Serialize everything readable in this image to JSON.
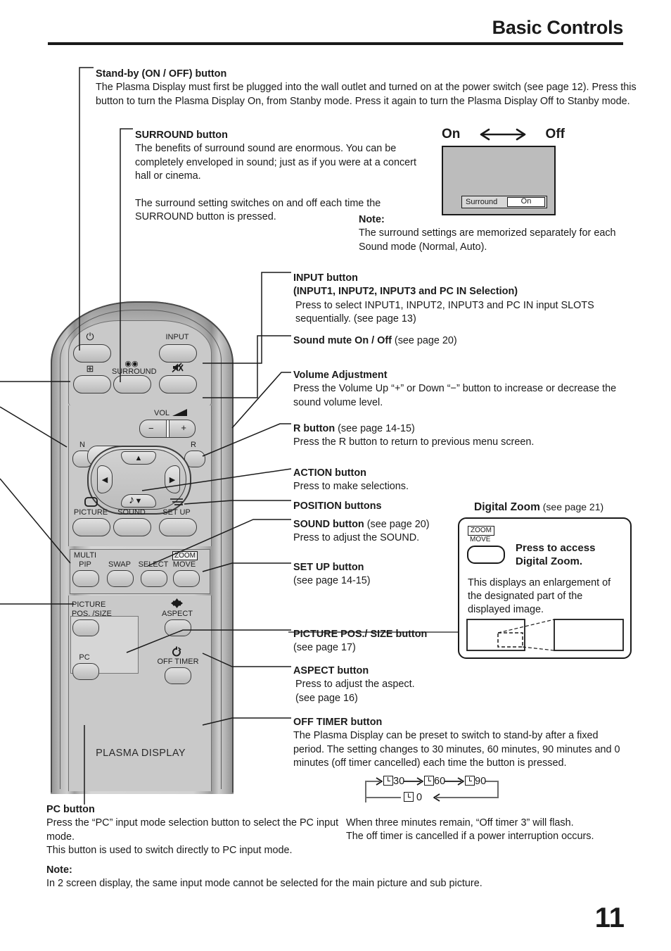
{
  "page": {
    "title": "Basic Controls",
    "number": "11"
  },
  "standby": {
    "heading": "Stand-by (ON / OFF) button",
    "body": "The Plasma Display must first be plugged into the wall outlet and turned on at the power switch (see page 12). Press this button to turn the Plasma Display On, from Stanby mode. Press it again to turn the Plasma Display Off to Stanby mode."
  },
  "surround": {
    "heading": "SURROUND button",
    "body1": "The benefits of surround sound are enormous. You can be completely enveloped in sound; just as if you were at a concert hall or cinema.",
    "body2": "The surround setting switches on and off each time the SURROUND button is pressed.",
    "note_heading": "Note:",
    "note_body": "The surround settings are memorized separately for each Sound mode (Normal, Auto).",
    "on_label": "On",
    "off_label": "Off",
    "osd_label": "Surround",
    "osd_value": "On"
  },
  "input": {
    "heading1": "INPUT button",
    "heading2": "(INPUT1, INPUT2, INPUT3 and PC IN Selection)",
    "body": "Press to select INPUT1, INPUT2, INPUT3 and PC IN input SLOTS sequentially. (see page 13)"
  },
  "mute": {
    "bold": "Sound mute On",
    "sep": " / ",
    "bold2": "Off",
    "normal": " (see page 20)"
  },
  "volume": {
    "heading": "Volume Adjustment",
    "body": "Press the Volume Up “+” or Down “−” button to increase or decrease the sound volume level."
  },
  "rbutton": {
    "heading": "R button",
    "heading_note": " (see page 14-15)",
    "body": "Press the R button to return to previous menu screen."
  },
  "action": {
    "heading": "ACTION button",
    "body": "Press to make selections."
  },
  "position": {
    "heading": "POSITION buttons"
  },
  "sound": {
    "heading": "SOUND button",
    "heading_note": " (see page 20)",
    "body": "Press to adjust the SOUND."
  },
  "setup": {
    "heading": "SET UP button",
    "body": "(see page 14-15)"
  },
  "picture_pos": {
    "heading": "PICTURE POS./ SIZE button",
    "body": "(see page 17)"
  },
  "aspect": {
    "heading": "ASPECT button",
    "body1": "Press to adjust the aspect.",
    "body2": "(see page 16)"
  },
  "offtimer": {
    "heading": "OFF TIMER button",
    "body": "The Plasma Display can be preset to switch to stand-by after a fixed period. The setting changes to 30 minutes, 60 minutes, 90 minutes and 0 minutes (off timer cancelled) each time the button is pressed.",
    "flow": [
      "30",
      "60",
      "90",
      "0"
    ],
    "footer1": "When three minutes remain, “Off timer 3” will flash.",
    "footer2": "The off timer is cancelled if a power interruption occurs."
  },
  "digital_zoom": {
    "title_bold": "Digital Zoom",
    "title_note": " (see page 21)",
    "zoom_tag": "ZOOM",
    "move_tag": "MOVE",
    "press_line1": "Press to access",
    "press_line2": "Digital Zoom.",
    "desc": "This displays an enlargement of the designated part of the displayed image."
  },
  "pc_button": {
    "heading": "PC button",
    "body1": "Press the “PC” input mode selection button to select the PC input mode.",
    "body2": "This button is used to switch directly to PC input mode."
  },
  "bottom_note": {
    "heading": "Note:",
    "body": "In 2 screen display, the same input mode cannot be selected for the main picture and sub picture."
  },
  "remote": {
    "brand_text": "PLASMA DISPLAY",
    "labels": {
      "power_icon": "⏻",
      "input": "INPUT",
      "surround": "SURROUND",
      "surround_icon": "◉◉",
      "mute_icon": "⛔",
      "pip_icon": "⊞",
      "vol": "VOL",
      "vol_minus": "−",
      "vol_plus": "+",
      "n": "N",
      "r": "R",
      "picture": "PICTURE",
      "sound": "SOUND",
      "setup": "SET UP",
      "multi": "MULTI",
      "pip": "PIP",
      "swap": "SWAP",
      "select": "SELECT",
      "zoom": "ZOOM",
      "move": "MOVE",
      "picture_pos1": "PICTURE",
      "picture_pos2": "POS. /SIZE",
      "aspect": "ASPECT",
      "pc": "PC",
      "off_timer": "OFF TIMER"
    }
  }
}
